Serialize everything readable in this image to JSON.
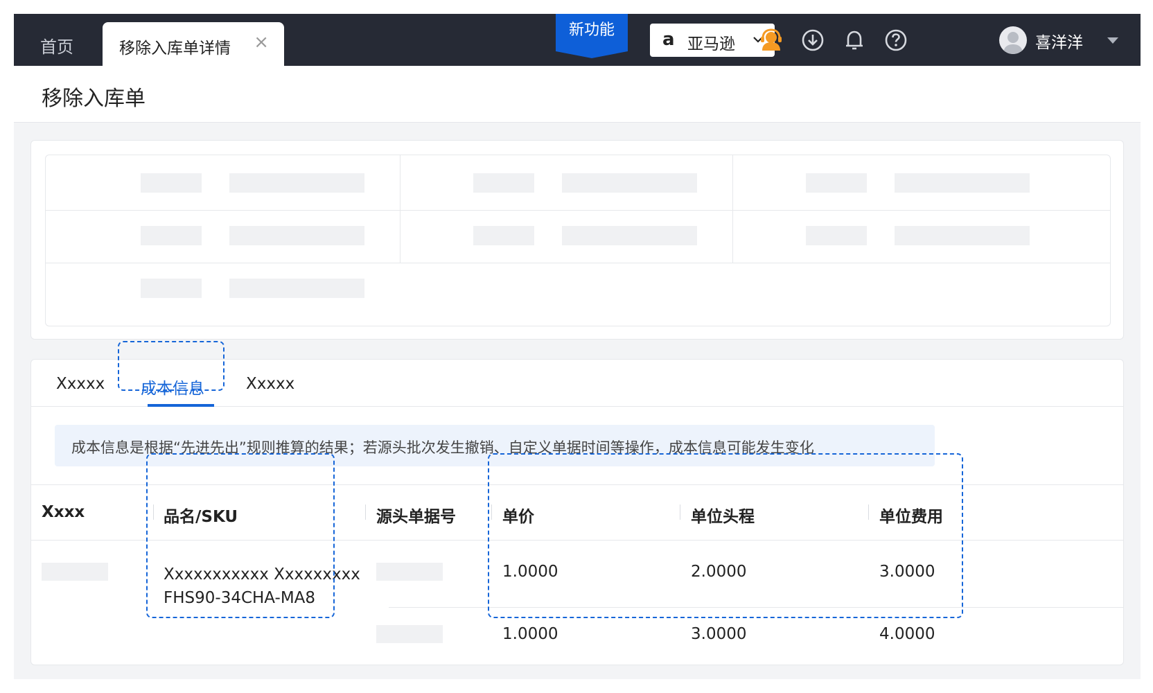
{
  "topbar": {
    "home_tab": "首页",
    "active_tab": "移除入库单详情",
    "close_glyph": "×",
    "new_feature": "新功能",
    "store": {
      "name": "亚马逊",
      "icon": "amazon-icon"
    },
    "icons": [
      "support-agent-icon",
      "download-icon",
      "bell-icon",
      "help-icon"
    ],
    "user": {
      "name": "喜洋洋"
    }
  },
  "page": {
    "title": "移除入库单"
  },
  "tabs": [
    "Xxxxx",
    "成本信息",
    "Xxxxx"
  ],
  "notice": "成本信息是根据“先进先出”规则推算的结果；若源头批次发生撤销、自定义单据时间等操作，成本信息可能发生变化",
  "table": {
    "headers": [
      "Xxxx",
      "品名/SKU",
      "源头单据号",
      "单价",
      "单位头程",
      "单位费用"
    ],
    "product": {
      "name": "Xxxxxxxxxxx Xxxxxxxxx",
      "sku": "FHS90-34CHA-MA8"
    },
    "rows": [
      {
        "unit_price": "1.0000",
        "unit_freight": "2.0000",
        "unit_fee": "3.0000"
      },
      {
        "unit_price": "1.0000",
        "unit_freight": "3.0000",
        "unit_fee": "4.0000"
      }
    ]
  },
  "colors": {
    "accent": "#1565d8",
    "topbar": "#262a35",
    "support_icon": "#f59a23"
  }
}
